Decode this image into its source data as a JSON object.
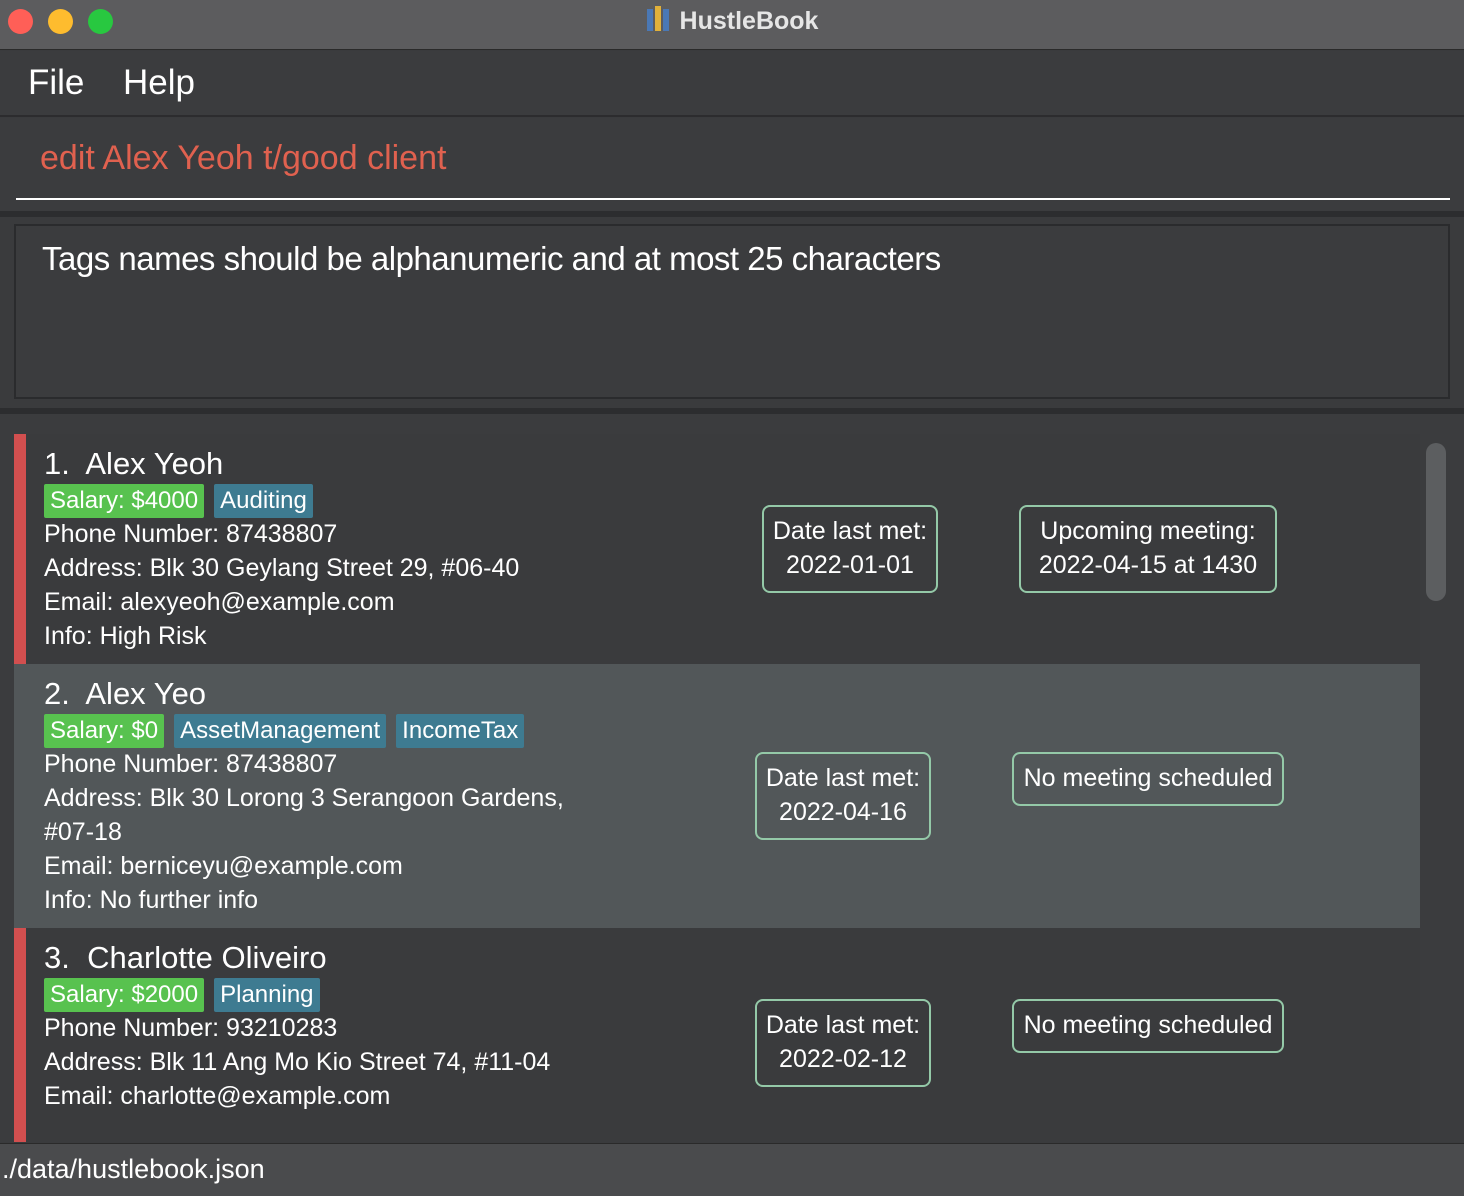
{
  "window": {
    "title": "HustleBook"
  },
  "menu": {
    "items": [
      "File",
      "Help"
    ]
  },
  "command": {
    "value": "edit Alex Yeoh t/good client"
  },
  "result": {
    "message": "Tags names should be alphanumeric and at most 25 characters"
  },
  "persons": [
    {
      "index": "1.",
      "name": "Alex Yeoh",
      "salary": "Salary: $4000",
      "tags": [
        "Auditing"
      ],
      "phone": "Phone Number: 87438807",
      "address_line1": "Address: Blk 30 Geylang Street 29, #06-40",
      "address_line2": "",
      "email": "Email: alexyeoh@example.com",
      "info": "Info: High Risk",
      "date_label": "Date last met:",
      "date_value": "2022-01-01",
      "meeting_line1": "Upcoming meeting:",
      "meeting_line2": "2022-04-15 at 1430",
      "flagged": true
    },
    {
      "index": "2.",
      "name": "Alex Yeo",
      "salary": "Salary: $0",
      "tags": [
        "AssetManagement",
        "IncomeTax"
      ],
      "phone": "Phone Number: 87438807",
      "address_line1": "Address: Blk 30 Lorong 3 Serangoon Gardens,",
      "address_line2": "#07-18",
      "email": "Email: berniceyu@example.com",
      "info": "Info: No further info",
      "date_label": "Date last met:",
      "date_value": "2022-04-16",
      "meeting_line1": "No meeting scheduled",
      "meeting_line2": "",
      "flagged": false
    },
    {
      "index": "3.",
      "name": "Charlotte Oliveiro",
      "salary": "Salary: $2000",
      "tags": [
        "Planning"
      ],
      "phone": "Phone Number: 93210283",
      "address_line1": "Address: Blk 11 Ang Mo Kio Street 74, #11-04",
      "address_line2": "",
      "email": "Email: charlotte@example.com",
      "info": "",
      "date_label": "Date last met:",
      "date_value": "2022-02-12",
      "meeting_line1": "No meeting scheduled",
      "meeting_line2": "",
      "flagged": true
    }
  ],
  "status": {
    "path": "./data/hustlebook.json"
  },
  "colors": {
    "command_text": "#e0614f",
    "flag_bar": "#d24f4f",
    "salary_tag": "#58c24f",
    "category_tag": "#3e7b91",
    "pill_border": "#94c9a8"
  }
}
